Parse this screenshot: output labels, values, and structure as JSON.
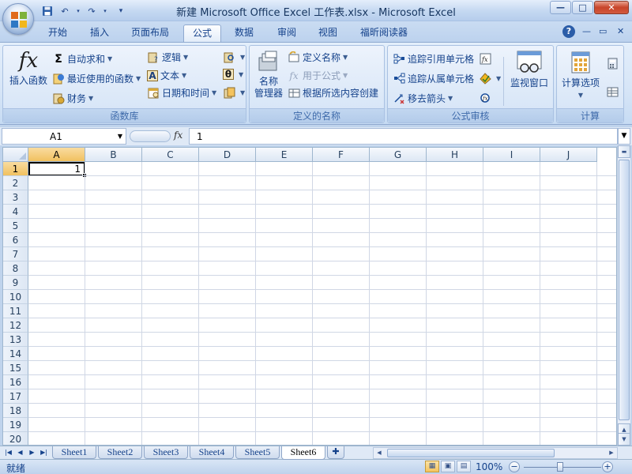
{
  "window": {
    "title": "新建 Microsoft Office Excel 工作表.xlsx - Microsoft Excel",
    "controls": [
      "—",
      "□",
      "✕"
    ]
  },
  "quick_access": {
    "save_icon": "save-icon",
    "undo_icon": "undo-icon",
    "redo_icon": "redo-icon"
  },
  "tabs": [
    {
      "label": "开始"
    },
    {
      "label": "插入"
    },
    {
      "label": "页面布局"
    },
    {
      "label": "公式",
      "active": true
    },
    {
      "label": "数据"
    },
    {
      "label": "审阅"
    },
    {
      "label": "视图"
    },
    {
      "label": "福昕阅读器"
    }
  ],
  "ribbon": {
    "groups": {
      "function_library": {
        "title": "函数库",
        "insert_function": "插入函数",
        "autosum": "自动求和",
        "recent": "最近使用的函数",
        "financial": "财务",
        "logical": "逻辑",
        "text": "文本",
        "datetime": "日期和时间"
      },
      "defined_names": {
        "title": "定义的名称",
        "name_manager_1": "名称",
        "name_manager_2": "管理器",
        "define_name": "定义名称",
        "use_in_formula": "用于公式",
        "create_from_selection": "根据所选内容创建"
      },
      "formula_auditing": {
        "title": "公式审核",
        "trace_precedents": "追踪引用单元格",
        "trace_dependents": "追踪从属单元格",
        "remove_arrows": "移去箭头",
        "watch_window": "监视窗口"
      },
      "calculation": {
        "title": "计算",
        "calc_options": "计算选项"
      }
    }
  },
  "formula_bar": {
    "name_box": "A1",
    "fx_label": "fx",
    "value": "1"
  },
  "sheet": {
    "columns": [
      "A",
      "B",
      "C",
      "D",
      "E",
      "F",
      "G",
      "H",
      "I",
      "J"
    ],
    "rows": [
      "1",
      "2",
      "3",
      "4",
      "5",
      "6",
      "7",
      "8",
      "9",
      "10",
      "11",
      "12",
      "13",
      "14",
      "15",
      "16",
      "17",
      "18",
      "19",
      "20"
    ],
    "selected_cell": "A1",
    "a1_value": "1"
  },
  "sheet_tabs": [
    "Sheet1",
    "Sheet2",
    "Sheet3",
    "Sheet4",
    "Sheet5",
    "Sheet6"
  ],
  "active_sheet": "Sheet6",
  "status": {
    "ready": "就绪",
    "zoom": "100%"
  }
}
